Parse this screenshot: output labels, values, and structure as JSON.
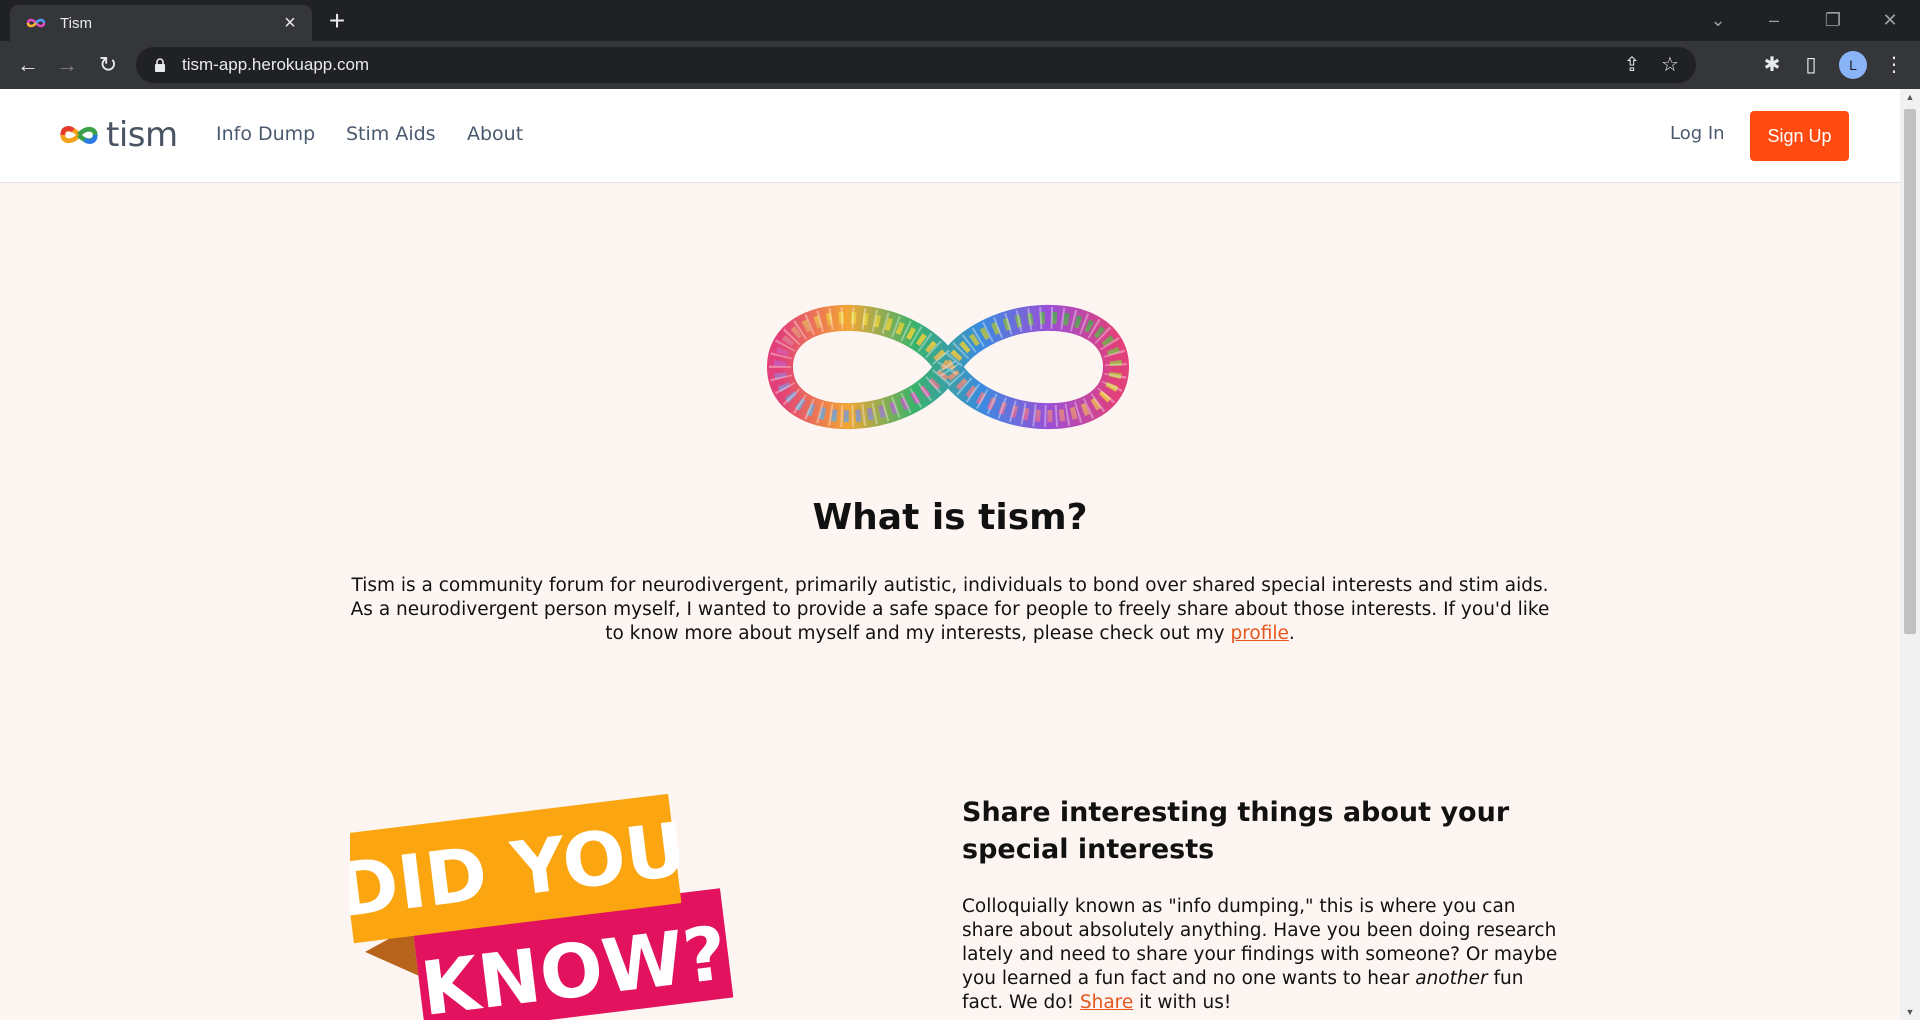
{
  "browser": {
    "tab_title": "Tism",
    "url": "tism-app.herokuapp.com",
    "profile_initial": "L"
  },
  "nav": {
    "brand": "tism",
    "links": [
      "Info Dump",
      "Stim Aids",
      "About"
    ],
    "login": "Log In",
    "signup": "Sign Up"
  },
  "hero": {
    "title": "What is tism?",
    "text_before_link": "Tism is a community forum for neurodivergent, primarily autistic, individuals to bond over shared special interests and stim aids. As a neurodivergent person myself, I wanted to provide a safe space for people to freely share about those interests. If you'd like to know more about myself and my interests, please check out my ",
    "link_text": "profile",
    "text_after_link": "."
  },
  "feature": {
    "graphic_line1": "DID YOU",
    "graphic_line2": "KNOW?",
    "title": "Share interesting things about your special interests",
    "text_part1": "Colloquially known as \"info dumping,\" this is where you can share about absolutely anything. Have you been doing research lately and need to share your findings with someone? Or maybe you learned a fun fact and no one wants to hear ",
    "text_em": "another",
    "text_part2": " fun fact. We do! ",
    "link_text": "Share",
    "text_part3": " it with us!"
  },
  "colors": {
    "accent": "#ff4b10",
    "link": "#e4561c",
    "page_bg": "#fdf5f2"
  }
}
